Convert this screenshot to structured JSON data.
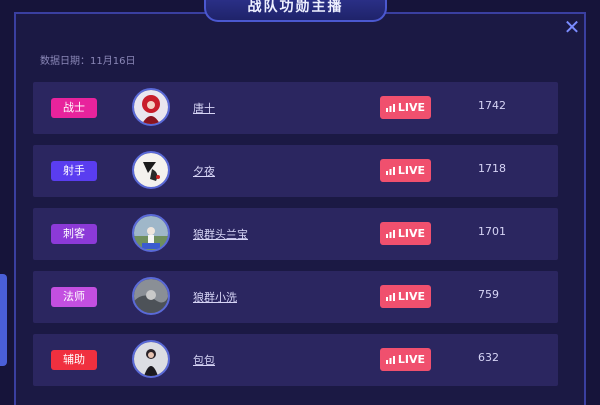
{
  "header": {
    "title": "战队功勋主播"
  },
  "meta": {
    "date_label": "数据日期：11月16日"
  },
  "colors": {
    "live": "#f0506e",
    "roles": [
      "#e8239c",
      "#5a3df0",
      "#8c3ad8",
      "#c34fe0",
      "#f0303f"
    ]
  },
  "live_label": "LIVE",
  "icons": [
    "close-icon",
    "live-bars-icon"
  ],
  "rows": [
    {
      "role": "战士",
      "name": "唐十",
      "score": "1742"
    },
    {
      "role": "射手",
      "name": "夕夜",
      "score": "1718"
    },
    {
      "role": "刺客",
      "name": "狼群头兰宝",
      "score": "1701"
    },
    {
      "role": "法师",
      "name": "狼群小洗",
      "score": "759"
    },
    {
      "role": "辅助",
      "name": "包包",
      "score": "632"
    }
  ]
}
